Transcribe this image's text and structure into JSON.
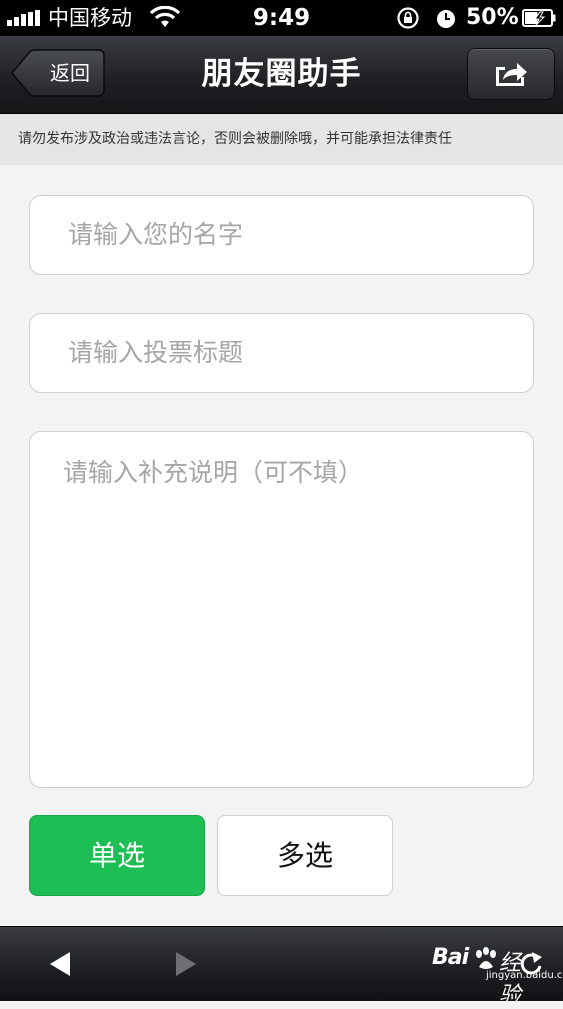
{
  "status_bar": {
    "carrier": "中国移动",
    "time": "9:49",
    "battery": "50%",
    "battery_level": 0.5,
    "icons": [
      "signal-icon",
      "wifi-icon",
      "rotation-lock-icon",
      "alarm-icon",
      "battery-icon"
    ]
  },
  "nav": {
    "back_label": "返回",
    "title": "朋友圈助手",
    "share_icon": "share-icon"
  },
  "notice": "请勿发布涉及政治或违法言论，否则会被删除哦，并可能承担法律责任",
  "form": {
    "name_placeholder": "请输入您的名字",
    "title_placeholder": "请输入投票标题",
    "desc_placeholder": "请输入补充说明（可不填）",
    "name_value": "",
    "title_value": "",
    "desc_value": ""
  },
  "options": {
    "single_label": "单选",
    "multi_label": "多选",
    "selected": "单选",
    "active_color": "#1dbf55"
  },
  "toolbar": {
    "icons": [
      "back-arrow-icon",
      "forward-arrow-icon",
      "refresh-icon"
    ]
  },
  "watermark": {
    "brand_a": "Bai",
    "brand_b": "经验",
    "url": "jingyan.baidu.com"
  }
}
